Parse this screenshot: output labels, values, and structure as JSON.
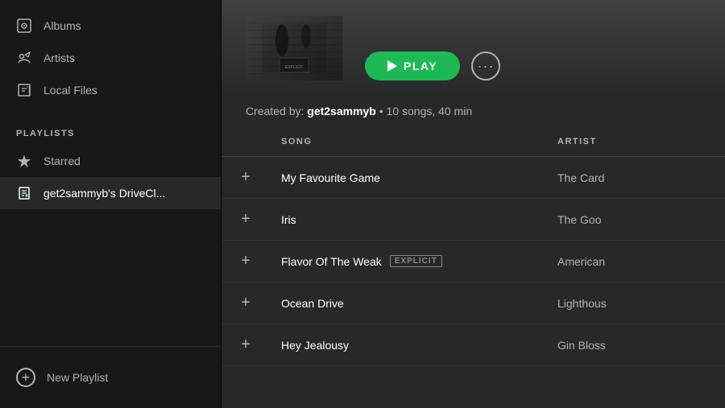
{
  "sidebar": {
    "nav_items": [
      {
        "id": "albums",
        "label": "Albums",
        "icon": "album-icon"
      },
      {
        "id": "artists",
        "label": "Artists",
        "icon": "artist-icon"
      },
      {
        "id": "local-files",
        "label": "Local Files",
        "icon": "local-files-icon"
      }
    ],
    "section_title": "PLAYLISTS",
    "playlist_items": [
      {
        "id": "starred",
        "label": "Starred",
        "icon": "star-icon",
        "active": false
      },
      {
        "id": "drive-cl",
        "label": "get2sammyb's DriveCl...",
        "icon": "note-icon",
        "active": true
      }
    ],
    "new_playlist_label": "New Playlist"
  },
  "header": {
    "play_label": "PLAY",
    "more_label": "···",
    "meta_text": "Created by: ",
    "meta_author": "get2sammyb",
    "meta_sep": " • ",
    "meta_info": "10 songs, 40 min"
  },
  "table": {
    "col_song": "SONG",
    "col_artist": "ARTIST",
    "rows": [
      {
        "song": "My Favourite Game",
        "artist": "The Card",
        "explicit": false,
        "add": "+"
      },
      {
        "song": "Iris",
        "artist": "The Goo",
        "explicit": false,
        "add": "+"
      },
      {
        "song": "Flavor Of The Weak",
        "artist": "American",
        "explicit": true,
        "explicit_label": "EXPLICIT",
        "add": "+"
      },
      {
        "song": "Ocean Drive",
        "artist": "Lighthous",
        "explicit": false,
        "add": "+"
      },
      {
        "song": "Hey Jealousy",
        "artist": "Gin Bloss",
        "explicit": false,
        "add": "+"
      }
    ]
  }
}
